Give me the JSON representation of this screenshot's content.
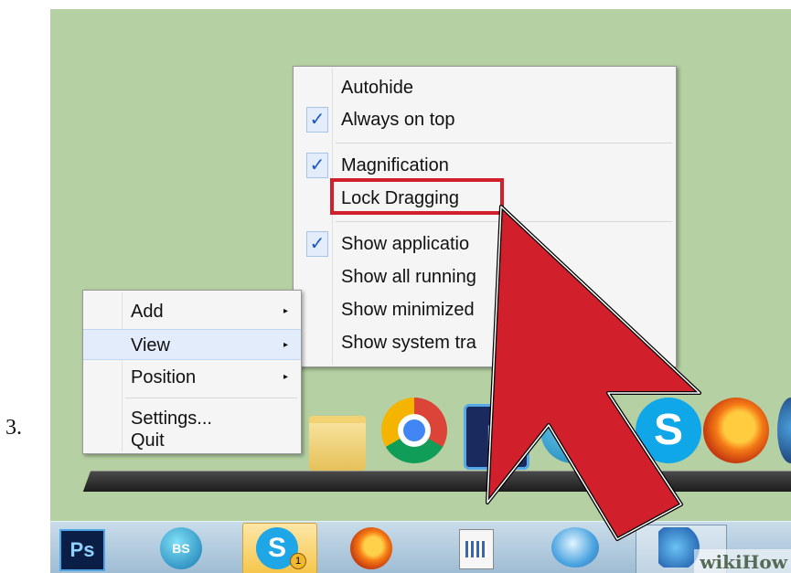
{
  "step": {
    "number": "3."
  },
  "view_submenu": {
    "items": [
      {
        "label": "Autohide",
        "checked": false
      },
      {
        "label": "Always on top",
        "checked": true
      },
      {
        "label": "Magnification",
        "checked": true
      },
      {
        "label": "Lock Dragging",
        "checked": false,
        "highlighted": true
      },
      {
        "label": "Show applicatio",
        "checked": true
      },
      {
        "label": "Show all running",
        "checked": false
      },
      {
        "label": "Show minimized",
        "checked": false
      },
      {
        "label": "Show system tra",
        "checked": false
      }
    ]
  },
  "context_menu": {
    "items": [
      {
        "label": "Add",
        "has_submenu": true
      },
      {
        "label": "View",
        "has_submenu": true,
        "hovered": true
      },
      {
        "label": "Position",
        "has_submenu": true
      },
      {
        "label": "Settings...",
        "has_submenu": false
      },
      {
        "label": "Quit",
        "has_submenu": false
      }
    ]
  },
  "dock": {
    "icons": [
      "folder-icon",
      "chrome-icon",
      "photoshop-icon",
      "bluestacks-icon",
      "skype-icon",
      "firefox-icon"
    ],
    "ps_label": "P",
    "skype_label": "S"
  },
  "taskbar": {
    "ps_label": "Ps",
    "bs_label": "BS",
    "skype_label": "S",
    "skype_badge": "1"
  },
  "watermark": "wikiHow",
  "colors": {
    "highlight": "#d11f2b",
    "arrow": "#d11f2b",
    "check": "#1a55c2",
    "background": "#b5d0a3"
  }
}
